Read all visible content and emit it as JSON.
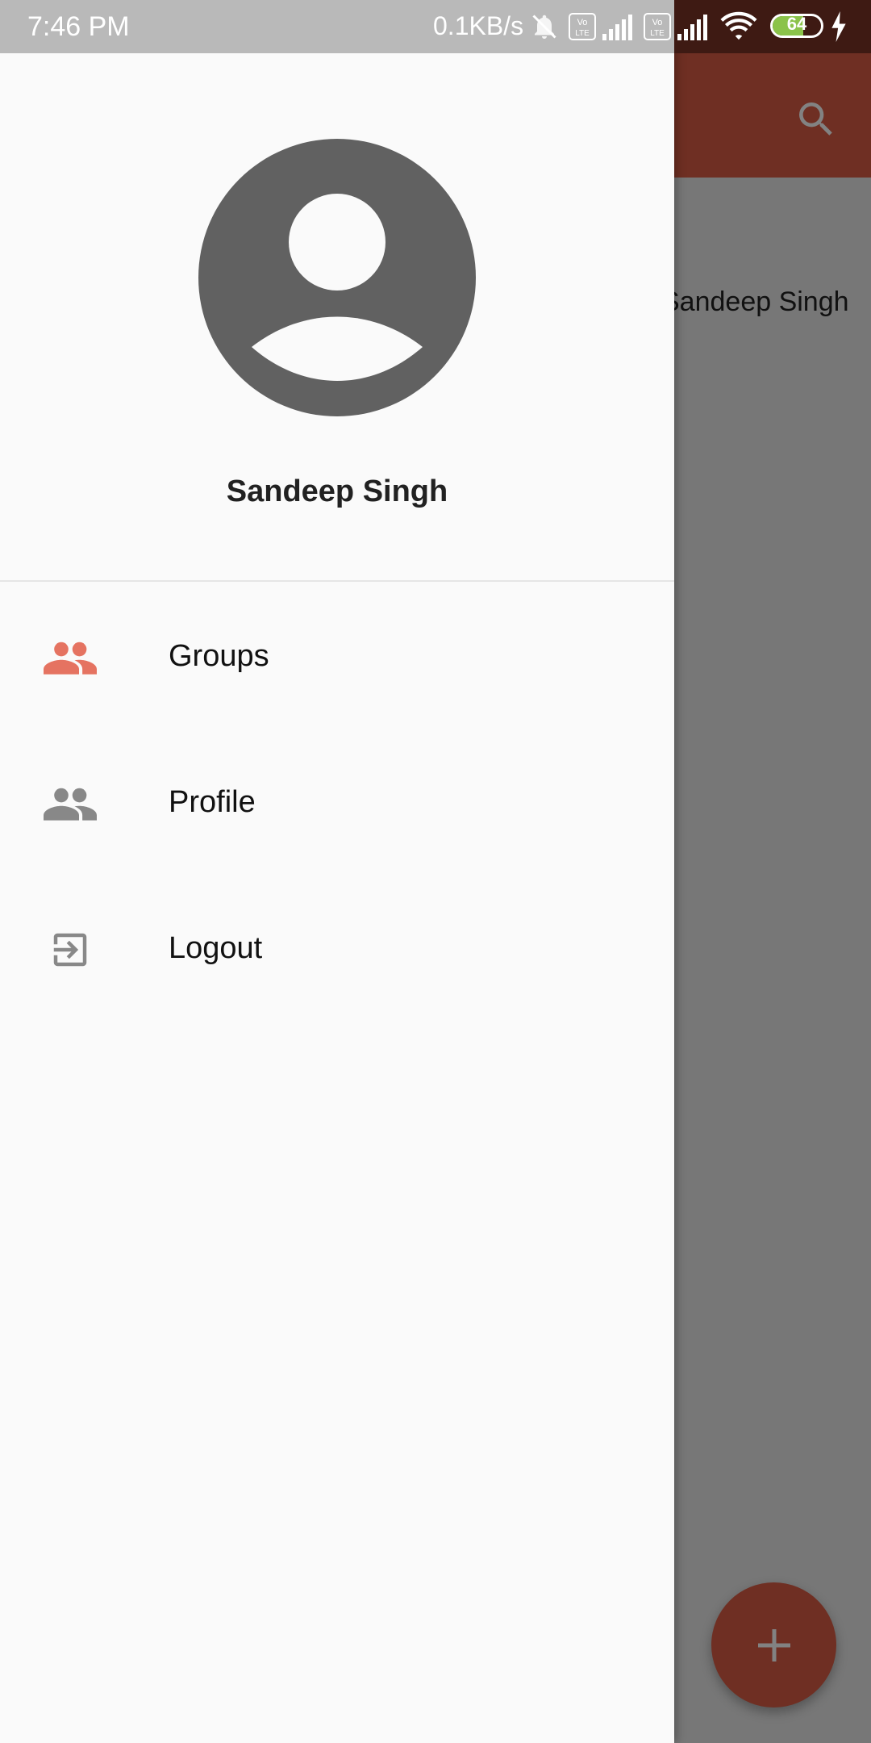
{
  "status_bar": {
    "time": "7:46 PM",
    "net_speed": "0.1KB/s",
    "battery_level": "64",
    "battery_fraction": 0.64,
    "icons": [
      "mute-icon",
      "volte-icon",
      "signal-icon",
      "volte-icon",
      "signal-icon",
      "wifi-icon",
      "battery-icon",
      "charging-icon"
    ]
  },
  "drawer": {
    "user_name": "Sandeep Singh",
    "items": [
      {
        "label": "Groups",
        "icon": "group-icon",
        "active": true
      },
      {
        "label": "Profile",
        "icon": "group-icon",
        "active": false
      },
      {
        "label": "Logout",
        "icon": "logout-icon",
        "active": false
      }
    ]
  },
  "background": {
    "list_text": "Sandeep Singh",
    "toolbar_icon": "search-icon",
    "fab_icon": "add-icon"
  },
  "colors": {
    "accent": "#e57361",
    "primary": "#d95c45",
    "icon_gray": "#888888",
    "drawer_bg": "#fafafa"
  }
}
